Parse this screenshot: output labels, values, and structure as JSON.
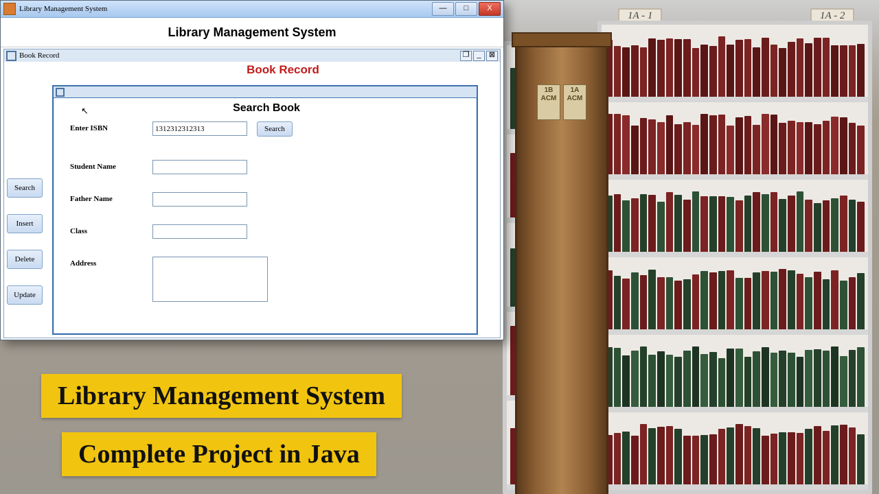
{
  "window": {
    "title": "Library Management System",
    "minimize_glyph": "—",
    "maximize_glyph": "□",
    "close_glyph": "X"
  },
  "header": {
    "title": "Library Management System"
  },
  "book_record": {
    "frame_title": "Book Record",
    "heading": "Book Record",
    "detach_glyph": "❐",
    "min_glyph": "_",
    "close_glyph": "⊠",
    "sidebar": {
      "search": "Search",
      "insert": "Insert",
      "delete": "Delete",
      "update": "Update"
    },
    "search_panel": {
      "title": "Search Book",
      "isbn_label": "Enter ISBN",
      "isbn_value": "1312312312313",
      "search_btn": "Search",
      "student_name_label": "Student Name",
      "student_name_value": "",
      "father_name_label": "Father Name",
      "father_name_value": "",
      "class_label": "Class",
      "class_value": "",
      "address_label": "Address",
      "address_value": ""
    }
  },
  "banners": {
    "line1": "Library Management System",
    "line2": "Complete Project in Java"
  },
  "library_signs": {
    "left": "1A - 1",
    "right": "1A - 2"
  },
  "pillar_tags": {
    "a": "1B\nACM",
    "b": "1A\nACM"
  }
}
